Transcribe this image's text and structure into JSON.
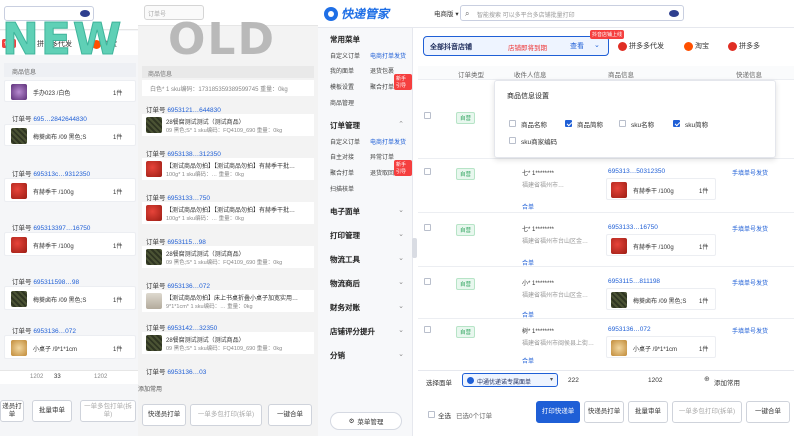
{
  "new_panel": {
    "overlay_word": "NEW",
    "tabs": [
      {
        "label": "拼多多代发",
        "color": "#e02e24"
      },
      {
        "label": "淘宝",
        "color": "#ff5000"
      },
      {
        "label": "拼多多",
        "color": "#e02e24"
      }
    ],
    "tab_badge": "代发",
    "grid_header": "商品信息",
    "orders": [
      {
        "product": "手办023 /白色",
        "qty": "1件"
      },
      {
        "prefix": "订单号",
        "number": "695…2842644830",
        "product": "梅葵卤布 /09 黑色;S",
        "qty": "1件"
      },
      {
        "prefix": "订单号",
        "number": "695313c…9312350",
        "product": "有赫季干 /100g",
        "qty": "1件"
      },
      {
        "prefix": "订单号",
        "number": "695313397…16750",
        "product": "有赫季干 /100g",
        "qty": "1件"
      },
      {
        "prefix": "订单号",
        "number": "695311598…98",
        "product": "梅葵卤布 /09 黑色;S",
        "qty": "1件"
      },
      {
        "prefix": "订单号",
        "number": "6953136…072",
        "product": "小桌子 /9*1*1cm",
        "qty": "1件"
      }
    ],
    "pagination": [
      "1202",
      "33",
      "1202"
    ],
    "buttons": [
      {
        "label": "递员打单"
      },
      {
        "label": "批量审单"
      },
      {
        "label": "一单多包打单(拆单)"
      }
    ]
  },
  "old_panel": {
    "overlay_word": "OLD",
    "search_placeholder": "订单号",
    "grid_header": "商品信息",
    "orders": [
      {
        "line": "白色* 1 sku编码：173185359389599745 重量：0kg",
        "qty": "1件"
      },
      {
        "prefix": "订单号",
        "number": "6953121…644830",
        "product": "28餐腐测试测试（测试商品）",
        "sub": "09 黑色;S* 1 sku编码：FQ4109_690 重量：0kg",
        "qty": "1件"
      },
      {
        "prefix": "订单号",
        "number": "6953138…312350",
        "product": "【测试商品勿拍】【测试商品勿拍】有赫季干批…",
        "sub": "100g* 1 sku编码：… 重量：0kg",
        "qty": "1件"
      },
      {
        "prefix": "订单号",
        "number": "6953133…750",
        "product": "【测试商品勿拍】【测试商品勿拍】有赫季干批…",
        "sub": "100g* 1 sku编码：… 重量：0kg",
        "qty": "1件"
      },
      {
        "prefix": "订单号",
        "number": "6953115…98",
        "product": "28餐腐测试测试（测试商品）",
        "sub": "09 黑色;S* 1 sku编码：FQ4109_690 重量：0kg",
        "qty": "1件"
      },
      {
        "prefix": "订单号",
        "number": "6953136…072",
        "product": "【测试商品勿拍】床上书桌折叠小桌子加宽实用…",
        "sub": "9*1*1cm* 1 sku编码：… 重量：0kg",
        "qty": "1件"
      },
      {
        "prefix": "订单号",
        "number": "6953142…32350",
        "product": "28餐腐测试测试（测试商品）",
        "sub": "09 黑色;S* 1 sku编码：FQ4109_690 重量：0kg",
        "qty": "1件"
      },
      {
        "prefix": "订单号",
        "number": "6953136…03"
      }
    ],
    "add_common": "添加常用",
    "buttons": [
      {
        "label": "快递员打单"
      },
      {
        "label": "一单多包打印(拆单)"
      },
      {
        "label": "一键合单"
      }
    ]
  },
  "app": {
    "brand": "快递管家",
    "platform_select": "电商版",
    "search_placeholder": "智能搜索  可以多平台多店铺批量打印",
    "promo": {
      "badge": "抖音店铺上线",
      "lead": "全部抖音店铺",
      "warning": "店铺即将到期",
      "action": "查看"
    },
    "tabs": [
      {
        "label": "拼多多代发",
        "color": "#e02e24"
      },
      {
        "label": "淘宝",
        "color": "#ff5000"
      },
      {
        "label": "拼多多",
        "color": "#e02e24"
      }
    ],
    "sidebar": {
      "sections": [
        {
          "title": "常用菜单",
          "items": [
            "自定义订单",
            "电商打单发货",
            "我的面单",
            "退货包裹",
            "模板设置",
            "聚合打单",
            "商品管理"
          ],
          "badge": "新手引导"
        },
        {
          "title": "订单管理",
          "items": [
            "自定义订单",
            "电商打单发货",
            "自主对接",
            "异常订单",
            "聚合打单",
            "退货取回",
            "扫描核单"
          ],
          "badge": "新手引导"
        },
        {
          "title": "电子面单",
          "items": []
        },
        {
          "title": "打印管理",
          "items": []
        },
        {
          "title": "物流工具",
          "items": []
        },
        {
          "title": "物流商后",
          "items": []
        },
        {
          "title": "财务对账",
          "items": []
        },
        {
          "title": "店铺评分提升",
          "items": []
        },
        {
          "title": "分销",
          "items": []
        }
      ],
      "menu_button": "菜单管理"
    },
    "table_headers": [
      "订单类型",
      "收件人信息",
      "商品信息",
      "快递信息"
    ],
    "settings_popover": {
      "title": "商品信息设置",
      "options": [
        {
          "label": "商品名称",
          "checked": false
        },
        {
          "label": "商品简称",
          "checked": true
        },
        {
          "label": "sku名称",
          "checked": false
        },
        {
          "label": "sku简称",
          "checked": true
        },
        {
          "label": "sku商家编码",
          "checked": false
        }
      ]
    },
    "rows": [
      {
        "type_tag": "自营",
        "recipient": "",
        "address": "",
        "order_no": "",
        "product": "",
        "qty": "",
        "action": ""
      },
      {
        "type_tag": "自营",
        "recipient": "七* 1********",
        "address": "福建省福州市…",
        "merge": "合单",
        "order_no": "695313…50312350",
        "product": "有赫季干 /100g",
        "qty": "1件",
        "action": "手填单号发货"
      },
      {
        "type_tag": "自营",
        "recipient": "七* 1********",
        "address": "福建省福州市台山区金…",
        "merge": "合单",
        "order_no": "6953133…16750",
        "product": "有赫季干 /100g",
        "qty": "1件",
        "action": "手填单号发货"
      },
      {
        "type_tag": "自营",
        "recipient": "小* 1********",
        "address": "福建省福州市台山区金…",
        "merge": "合单",
        "order_no": "6953115…811198",
        "product": "梅葵卤布 /09 黑色;S",
        "qty": "1件",
        "action": "手填单号发货"
      },
      {
        "type_tag": "自营",
        "recipient": "树* 1********",
        "address": "福建省福州市闽侯县上街…",
        "merge": "合单",
        "order_no": "6953136…072",
        "product": "小桌子 /9*1*1cm",
        "qty": "1件",
        "action": "手填单号发货"
      }
    ],
    "footer": {
      "select_label": "选择面单",
      "waybill": "中通优递诺专属面单",
      "count1": "222",
      "count2": "1202",
      "add_common": "添加常用",
      "select_all": "全选",
      "selected": "已选0个订单",
      "buttons": [
        {
          "label": "打印快递单",
          "primary": true
        },
        {
          "label": "快递员打单"
        },
        {
          "label": "批量审单"
        },
        {
          "label": "一单多包打印(拆单)",
          "disabled": true
        },
        {
          "label": "一键合单"
        }
      ]
    }
  }
}
